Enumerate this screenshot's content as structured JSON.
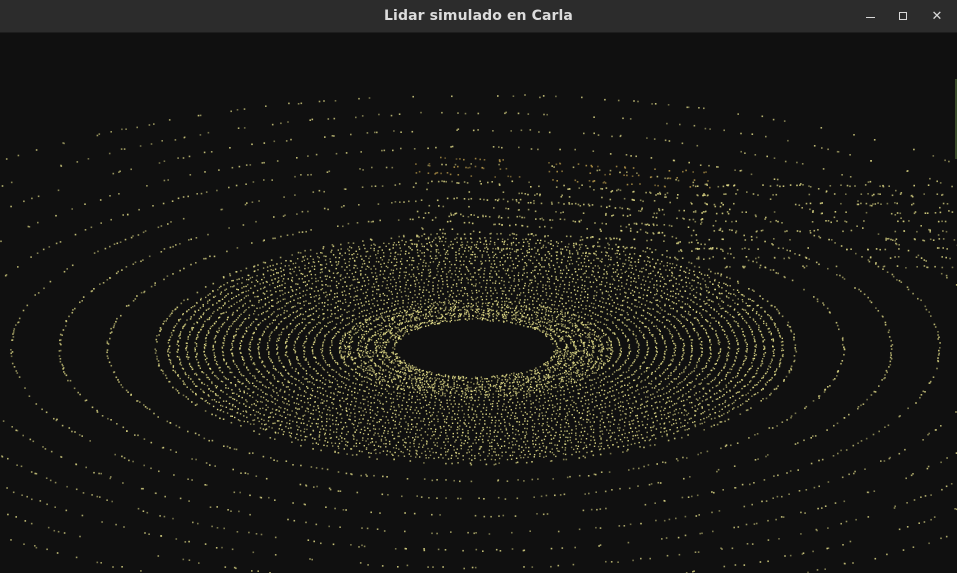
{
  "window": {
    "title": "Lidar simulado en Carla",
    "controls": {
      "minimize_icon": "minimize-icon",
      "maximize_icon": "maximize-icon",
      "close_icon": "close-icon",
      "close_glyph": "✕"
    }
  },
  "viewport": {
    "background": "#101010",
    "point_color": "#e6e08a",
    "far_point_color": "#b89a4a"
  }
}
